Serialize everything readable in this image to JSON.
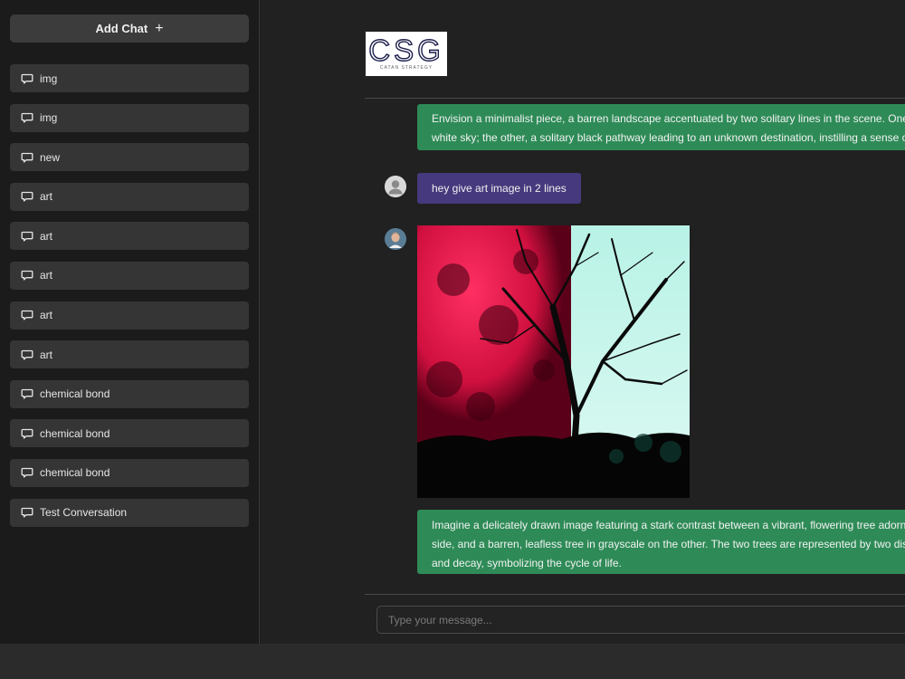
{
  "sidebar": {
    "add_chat_label": "Add Chat",
    "add_chat_icon": "+",
    "items": [
      {
        "label": "img"
      },
      {
        "label": "img"
      },
      {
        "label": "new"
      },
      {
        "label": "art"
      },
      {
        "label": "art"
      },
      {
        "label": "art"
      },
      {
        "label": "art"
      },
      {
        "label": "art"
      },
      {
        "label": "chemical bond"
      },
      {
        "label": "chemical bond"
      },
      {
        "label": "chemical bond"
      },
      {
        "label": "Test Conversation"
      }
    ],
    "item_icon": "chat-bubble-icon"
  },
  "header": {
    "logo_text": "CSG",
    "logo_subtext": "CATAN STRATEGY"
  },
  "messages": {
    "first_reply_line1": "Envision a minimalist piece, a barren landscape accentuated by two solitary lines in the scene. One",
    "first_reply_line2": "white sky; the other, a solitary black pathway leading to an unknown destination, instilling a sense o",
    "user_message": "hey give art image in 2 lines",
    "image_reply_line1": "Imagine a delicately drawn image featuring a stark contrast between a vibrant, flowering tree adorn",
    "image_reply_line2": "side, and a barren, leafless tree in grayscale on the other. The two trees are represented by two dist",
    "image_reply_line3": "and decay, symbolizing the cycle of life."
  },
  "composer": {
    "placeholder": "Type your message..."
  },
  "colors": {
    "assistant_bubble": "#2e8b57",
    "user_bubble": "#46397d",
    "sidebar_bg": "#1b1b1b",
    "main_bg": "#212121"
  }
}
